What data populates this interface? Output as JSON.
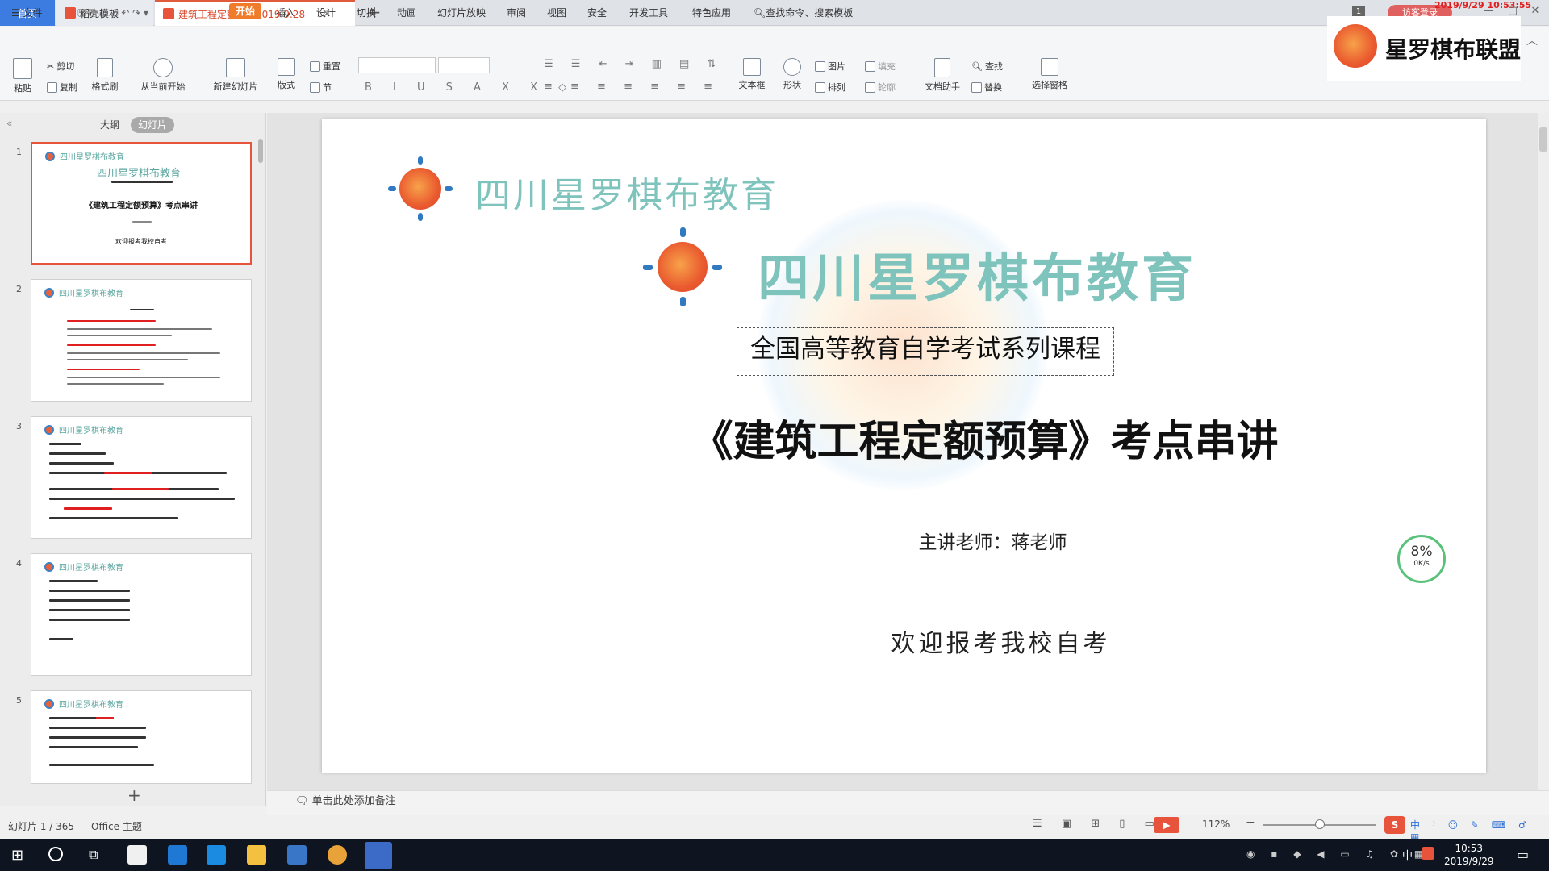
{
  "tabs": {
    "home": "首页",
    "daoke": "稻壳模板",
    "doc": "建筑工程定额预算2019.9.28"
  },
  "top_right": {
    "login": "访客登录",
    "timestamp": "2019/9/29 10:53:55",
    "page_badge": "1"
  },
  "menu": {
    "file": "文件",
    "start": "开始",
    "insert": "插入",
    "design": "设计",
    "transition": "切换",
    "animation": "动画",
    "slideshow": "幻灯片放映",
    "review": "审阅",
    "view": "视图",
    "security": "安全",
    "devtools": "开发工具",
    "special": "特色应用",
    "search": "查找命令、搜索模板"
  },
  "ribbon": {
    "paste": "粘贴",
    "cut": "剪切",
    "copy": "复制",
    "format_painter": "格式刷",
    "from_current": "从当前开始",
    "new_slide": "新建幻灯片",
    "layout": "版式",
    "reset": "重置",
    "section": "节",
    "textbox": "文本框",
    "shape": "形状",
    "picture": "图片",
    "arrange": "排列",
    "fill": "填充",
    "outline": "轮廓",
    "doc_helper": "文档助手",
    "find": "查找",
    "replace": "替换",
    "select_pane": "选择窗格"
  },
  "brand": {
    "name": "星罗棋布联盟"
  },
  "left_pane": {
    "outline_tab": "大纲",
    "slides_tab": "幻灯片",
    "thumb_org": "四川星罗棋布教育",
    "thumb1_title": "《建筑工程定额预算》考点串讲",
    "thumb1_welcome": "欢迎报考我校自考",
    "numbers": [
      "1",
      "2",
      "3",
      "4",
      "5"
    ]
  },
  "slide": {
    "org_small": "四川星罗棋布教育",
    "org_big": "四川星罗棋布教育",
    "subtitle": "全国高等教育自学考试系列课程",
    "title": "《建筑工程定额预算》考点串讲",
    "teacher": "主讲老师：蒋老师",
    "welcome": "欢迎报考我校自考"
  },
  "net_meter": {
    "percent": "8%",
    "speed": "0K/s"
  },
  "notes": {
    "placeholder": "单击此处添加备注"
  },
  "status": {
    "slide_count": "幻灯片 1 / 365",
    "theme": "Office 主题",
    "zoom": "112%"
  },
  "taskbar": {
    "time": "10:53",
    "date": "2019/9/29",
    "ime": "中"
  },
  "colors": {
    "accent_orange": "#f07b2a",
    "tab_blue": "#3c7be0",
    "teal_text": "#7fc3bd",
    "selection_red": "#e8533b"
  }
}
